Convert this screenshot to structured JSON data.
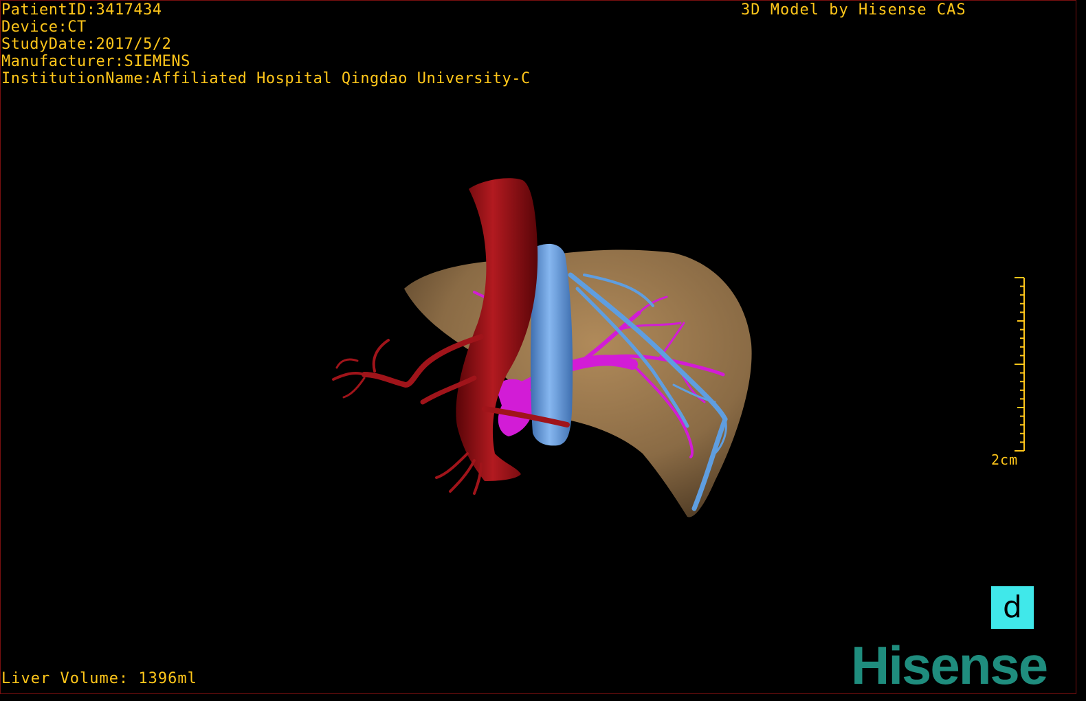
{
  "header": {
    "patient_id": "PatientID:3417434",
    "device": "Device:CT",
    "study_date": "StudyDate:2017/5/2",
    "manufacturer": "Manufacturer:SIEMENS",
    "institution": "InstitutionName:Affiliated Hospital Qingdao University-C"
  },
  "credit": "3D Model by Hisense CAS",
  "liver_volume": "Liver Volume: 1396ml",
  "scale_bar": {
    "label": "2cm"
  },
  "orientation_cube": {
    "label": "d"
  },
  "brand_logo": "Hisense",
  "colors": {
    "overlay_text": "#ffc61a",
    "liver": "#8a6b45",
    "artery": "#9e0f14",
    "portal_vein": "#d21cd6",
    "hepatic_vein": "#5f9ee0",
    "orientation_cube": "#40e8ea",
    "logo": "#1f8d7e",
    "frame": "#7a1010"
  }
}
